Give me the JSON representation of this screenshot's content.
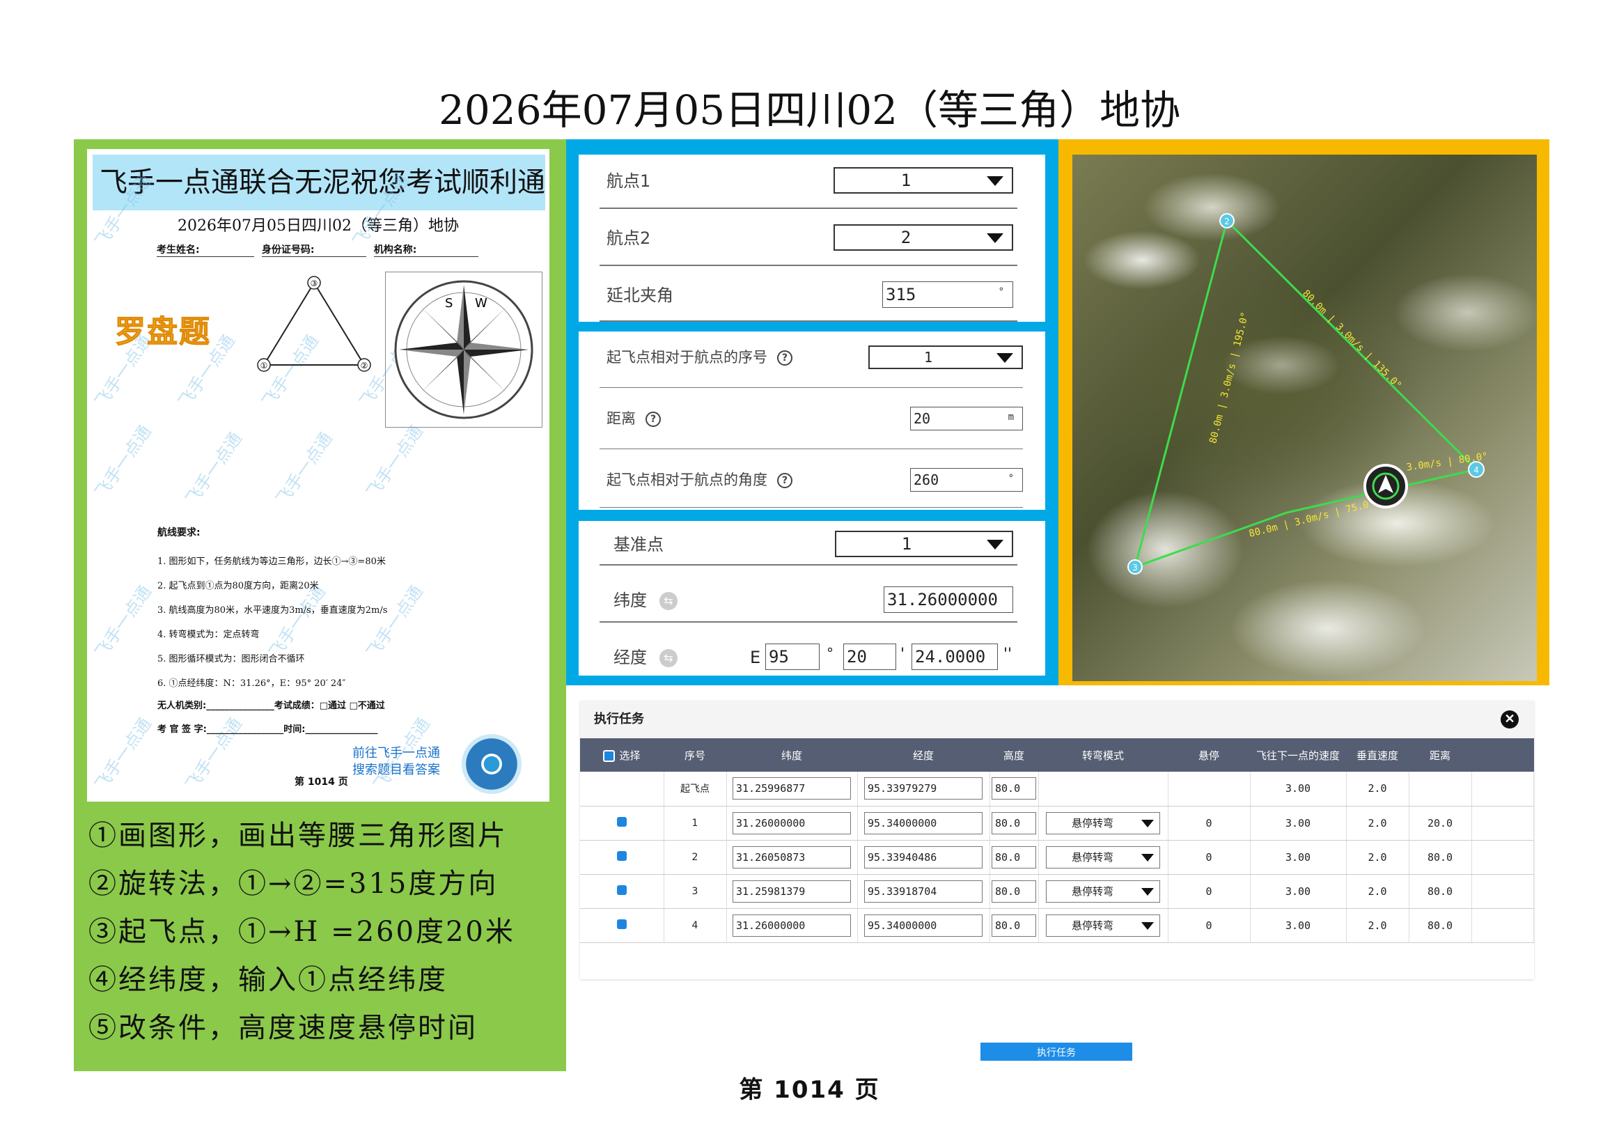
{
  "page_title": "2026年07月05日四川02（等三角）地协",
  "page_number": "第  1014  页",
  "paper": {
    "banner": "飞手一点通联合无泥祝您考试顺利通过",
    "title": "2026年07月05日四川02（等三角）地协",
    "info_labels": [
      "考生姓名:",
      "身份证号码:",
      "机构名称:"
    ],
    "compass_title": "罗盘题",
    "watermark": "飞手一点通",
    "tri_labels": [
      "①",
      "②",
      "③"
    ],
    "compass_letters": {
      "s": "S",
      "w": "W"
    },
    "req_title": "航线要求:",
    "requirements": [
      "1. 图形如下，任务航线为等边三角形，边长①→③=80米",
      "2. 起飞点到①点为80度方向，距离20米",
      "3. 航线高度为80米，水平速度为3m/s，垂直速度为2m/s",
      "4. 转弯模式为：定点转弯",
      "5. 图形循环模式为：图形闭合不循环",
      "6. ①点经纬度：N：31.26°，E：95° 20′ 24″"
    ],
    "uav_line": "无人机类别:_______________考试成绩：□通过  □不通过",
    "sign_line": "考 官 签 字:_________________时间:________________",
    "goto_line1": "前往飞手一点通",
    "goto_line2": "搜索题目看答案",
    "footer_page": "第 1014 页"
  },
  "steps": [
    "①画图形，画出等腰三角形图片",
    "②旋转法，①→②=315度方向",
    "③起飞点，①→H =260度20米",
    "④经纬度，输入①点经纬度",
    "⑤改条件，高度速度悬停时间"
  ],
  "form1": {
    "wp1_label": "航点1",
    "wp1_value": "1",
    "wp2_label": "航点2",
    "wp2_value": "2",
    "angle_label": "延北夹角",
    "angle_value": "315",
    "angle_unit": "°"
  },
  "form2": {
    "seq_label": "起飞点相对于航点的序号",
    "seq_value": "1",
    "dist_label": "距离",
    "dist_value": "20",
    "dist_unit": "m",
    "ang_label": "起飞点相对于航点的角度",
    "ang_value": "260",
    "ang_unit": "°",
    "help": "?"
  },
  "form3": {
    "ref_label": "基准点",
    "ref_value": "1",
    "lat_label": "纬度",
    "lat_value": "31.26000000",
    "lon_label": "经度",
    "lon_prefix": "E",
    "lon_deg": "95",
    "lon_min": "20",
    "lon_sec": "24.0000",
    "deg_sym": "°",
    "min_sym": "'",
    "sec_sym": "''",
    "swap": "⇆"
  },
  "map": {
    "waypoints": [
      "1",
      "2",
      "3",
      "4"
    ],
    "leg_labels": [
      "80.0m | 3.0m/s | 135.0°",
      "80.0m | 3.0m/s | 195.0°",
      "80.0m | 3.0m/s | 75.0°",
      "3.0m/s | 80.0°"
    ],
    "home_label": "H"
  },
  "task": {
    "title": "执行任务",
    "close": "✕",
    "columns": [
      "选择",
      "序号",
      "纬度",
      "经度",
      "高度",
      "转弯模式",
      "悬停",
      "飞往下一点的速度",
      "垂直速度",
      "距离"
    ],
    "rows": [
      {
        "check": false,
        "seq": "起飞点",
        "lat": "31.25996877",
        "lon": "95.33979279",
        "alt": "80.0",
        "turn": "",
        "hover": "",
        "speed": "3.00",
        "vspeed": "2.0",
        "dist": ""
      },
      {
        "check": true,
        "seq": "1",
        "lat": "31.26000000",
        "lon": "95.34000000",
        "alt": "80.0",
        "turn": "悬停转弯",
        "hover": "0",
        "speed": "3.00",
        "vspeed": "2.0",
        "dist": "20.0"
      },
      {
        "check": true,
        "seq": "2",
        "lat": "31.26050873",
        "lon": "95.33940486",
        "alt": "80.0",
        "turn": "悬停转弯",
        "hover": "0",
        "speed": "3.00",
        "vspeed": "2.0",
        "dist": "80.0"
      },
      {
        "check": true,
        "seq": "3",
        "lat": "31.25981379",
        "lon": "95.33918704",
        "alt": "80.0",
        "turn": "悬停转弯",
        "hover": "0",
        "speed": "3.00",
        "vspeed": "2.0",
        "dist": "80.0"
      },
      {
        "check": true,
        "seq": "4",
        "lat": "31.26000000",
        "lon": "95.34000000",
        "alt": "80.0",
        "turn": "悬停转弯",
        "hover": "0",
        "speed": "3.00",
        "vspeed": "2.0",
        "dist": "80.0"
      }
    ],
    "exec_button": "执行任务"
  }
}
